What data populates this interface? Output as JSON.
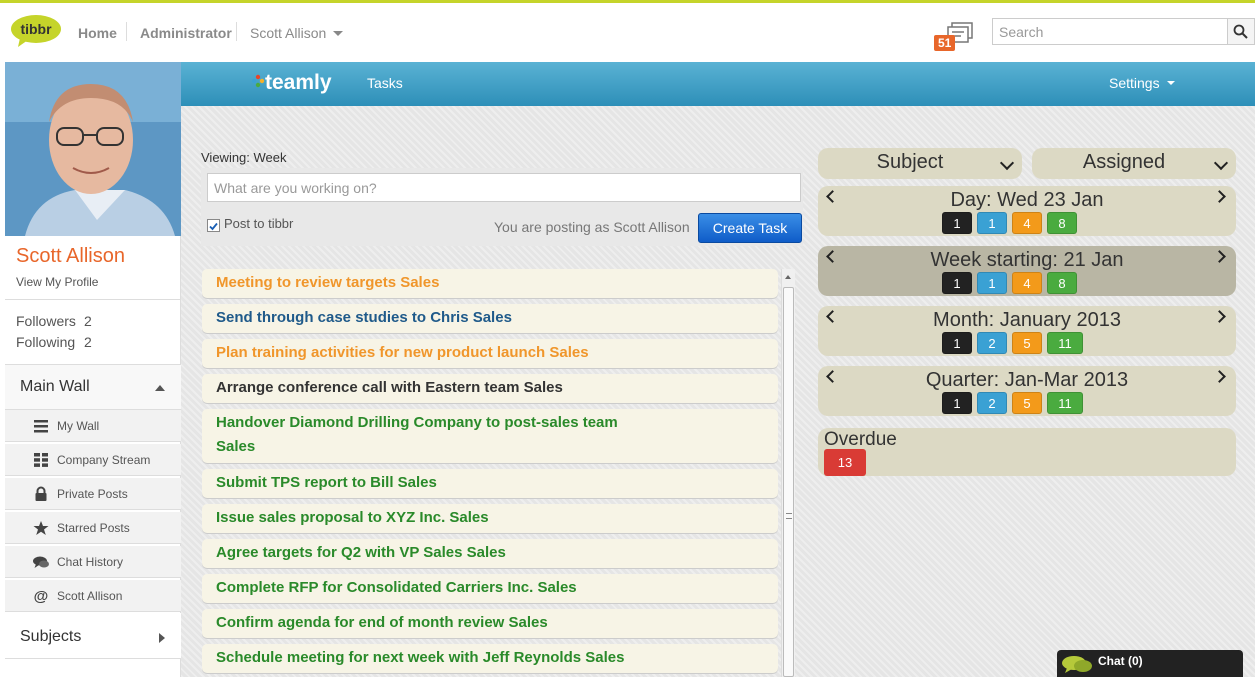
{
  "topbar": {
    "logo_text": "tibbr",
    "nav": [
      "Home",
      "Administrator",
      "Scott Allison"
    ],
    "notification_count": "51",
    "search_placeholder": "Search"
  },
  "sidebar": {
    "profile_name": "Scott Allison",
    "view_profile": "View My Profile",
    "followers_label": "Followers",
    "followers_count": "2",
    "following_label": "Following",
    "following_count": "2",
    "main_wall": "Main Wall",
    "items": [
      {
        "label": "My Wall",
        "icon": "list-icon"
      },
      {
        "label": "Company Stream",
        "icon": "grid-icon"
      },
      {
        "label": "Private Posts",
        "icon": "lock-icon"
      },
      {
        "label": "Starred Posts",
        "icon": "star-icon"
      },
      {
        "label": "Chat History",
        "icon": "chat-bubble-icon"
      },
      {
        "label": "Scott Allison",
        "icon": "at-icon"
      }
    ],
    "subjects": "Subjects"
  },
  "teamly": {
    "logo": "teamly",
    "tasks": "Tasks",
    "settings": "Settings"
  },
  "compose": {
    "viewing": "Viewing: Week",
    "placeholder": "What are you working on?",
    "post_to": "Post to tibbr",
    "post_checked": true,
    "posting_as": "You are posting as Scott Allison",
    "create_button": "Create Task"
  },
  "tasks": [
    {
      "text": "Meeting to review targets Sales",
      "color": "#f0962b"
    },
    {
      "text": "Send through case studies to Chris Sales",
      "color": "#1f5a8a"
    },
    {
      "text": "Plan training activities for new product launch Sales",
      "color": "#f0962b"
    },
    {
      "text": "Arrange conference call with Eastern team Sales",
      "color": "#333333"
    },
    {
      "text": "Handover Diamond Drilling Company to post-sales team Sales",
      "color": "#2a8a2a"
    },
    {
      "text": "Submit TPS report to Bill Sales",
      "color": "#2a8a2a"
    },
    {
      "text": "Issue sales proposal to XYZ Inc. Sales",
      "color": "#2a8a2a"
    },
    {
      "text": "Agree targets for Q2 with VP Sales Sales",
      "color": "#2a8a2a"
    },
    {
      "text": "Complete RFP for Consolidated Carriers Inc. Sales",
      "color": "#2a8a2a"
    },
    {
      "text": "Confirm agenda for end of month review Sales",
      "color": "#2a8a2a"
    },
    {
      "text": "Schedule meeting for next week with Jeff Reynolds Sales",
      "color": "#2a8a2a"
    }
  ],
  "filters": {
    "subject": "Subject",
    "assigned": "Assigned"
  },
  "periods": [
    {
      "label": "Day: Wed 23 Jan",
      "counts": [
        "1",
        "1",
        "4",
        "8"
      ],
      "active": false
    },
    {
      "label": "Week starting: 21 Jan",
      "counts": [
        "1",
        "1",
        "4",
        "8"
      ],
      "active": true
    },
    {
      "label": "Month: January 2013",
      "counts": [
        "1",
        "2",
        "5",
        "11"
      ],
      "active": false
    },
    {
      "label": "Quarter: Jan-Mar 2013",
      "counts": [
        "1",
        "2",
        "5",
        "11"
      ],
      "active": false
    }
  ],
  "overdue": {
    "label": "Overdue",
    "count": "13"
  },
  "chat": {
    "label": "Chat (0)"
  }
}
